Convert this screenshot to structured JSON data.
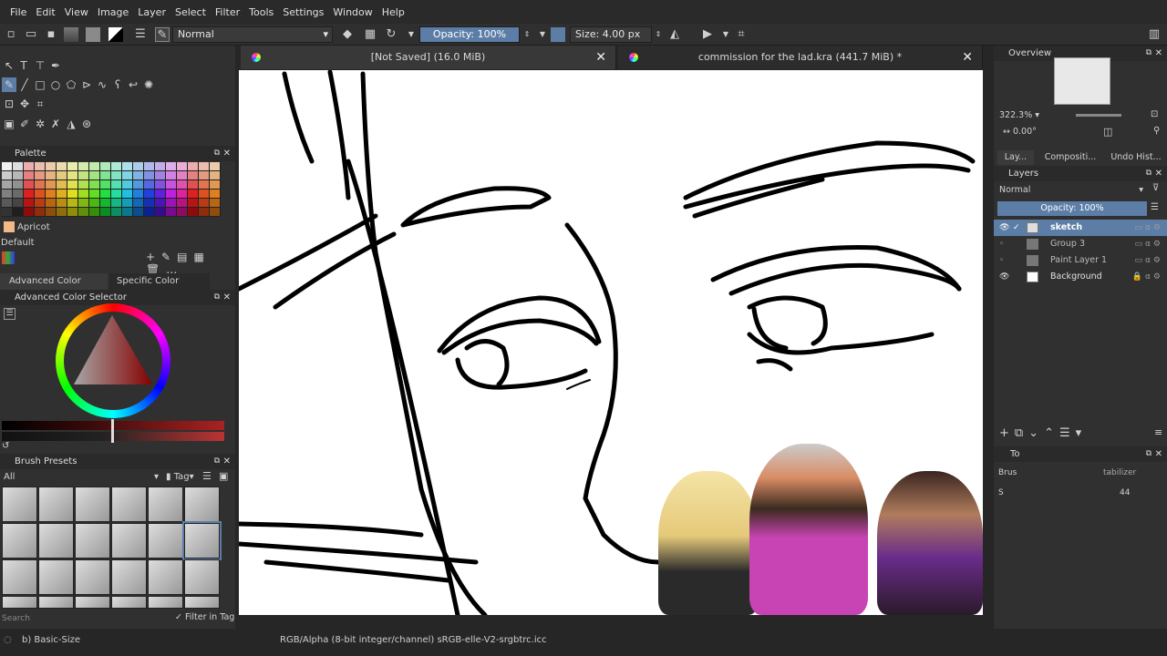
{
  "menu": [
    "File",
    "Edit",
    "View",
    "Image",
    "Layer",
    "Select",
    "Filter",
    "Tools",
    "Settings",
    "Window",
    "Help"
  ],
  "toolbar": {
    "blend_mode": "Normal",
    "opacity": "Opacity: 100%",
    "size": "Size: 4.00 px"
  },
  "tabs": [
    {
      "title": "[Not Saved]  (16.0 MiB)"
    },
    {
      "title": "commission for the lad.kra (441.7 MiB) *"
    }
  ],
  "palette": {
    "title": "Palette",
    "current_color_name": "Apricot",
    "set_name": "Default"
  },
  "color_selector": {
    "tab_advanced": "Advanced Color Selector",
    "tab_specific": "Specific Color Selector",
    "panel_title": "Advanced Color Selector"
  },
  "brush_presets": {
    "title": "Brush Presets",
    "filter_value": "All",
    "tag_label": "Tag",
    "search_placeholder": "Search",
    "filter_in_tag": "Filter in Tag"
  },
  "overview": {
    "title": "Overview",
    "zoom": "322.3%",
    "rotation": "0.00°"
  },
  "right_tabs": [
    "Lay...",
    "Compositi...",
    "Undo Hist..."
  ],
  "layers": {
    "title": "Layers",
    "blend_mode": "Normal",
    "opacity": "Opacity:  100%",
    "items": [
      {
        "name": "sketch",
        "visible": true,
        "selected": true
      },
      {
        "name": "Group 3",
        "visible": false,
        "selected": false
      },
      {
        "name": "Paint Layer 1",
        "visible": false,
        "selected": false
      },
      {
        "name": "Background",
        "visible": true,
        "selected": false
      }
    ]
  },
  "tool_options": {
    "title": "To",
    "label1": "Brus",
    "label2": "S",
    "stabilizer": "tabilizer",
    "value": "44"
  },
  "status": {
    "brush": "b) Basic-Size",
    "color_info": "RGB/Alpha (8-bit integer/channel)  sRGB-elle-V2-srgbtrc.icc"
  },
  "colors": {
    "accent": "#5c7ea6",
    "panel": "#303030",
    "canvas": "#ffffff",
    "overlay_pink": "#c844b4"
  }
}
